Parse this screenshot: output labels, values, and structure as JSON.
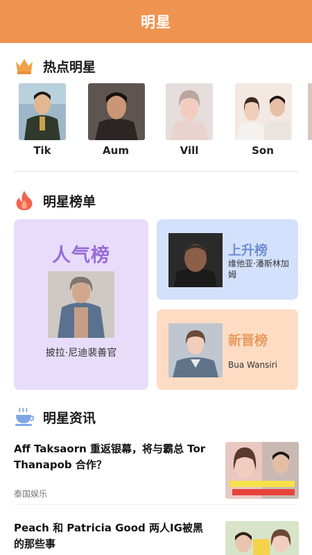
{
  "header": {
    "title": "明星"
  },
  "hot_stars": {
    "title": "热点明星",
    "icon": "crown-icon",
    "items": [
      {
        "name": "Tik"
      },
      {
        "name": "Aum"
      },
      {
        "name": "Vill"
      },
      {
        "name": "Son"
      }
    ]
  },
  "ranking": {
    "title": "明星榜单",
    "icon": "flame-icon",
    "popular": {
      "title": "人气榜",
      "star": "披拉·尼迪裴善官"
    },
    "rising": {
      "title": "上升榜",
      "star": "维他亚·潘斯林加姆"
    },
    "new": {
      "title": "新晋榜",
      "star": "Bua Wansiri"
    }
  },
  "news": {
    "title": "明星资讯",
    "icon": "coffee-cup-icon",
    "items": [
      {
        "title": "Aff Taksaorn 重返银幕，将与霸总 Tor Thanapob 合作？",
        "tag": "泰国娱乐"
      },
      {
        "title": "Peach 和 Patricia Good 两人IG被黑的那些事",
        "tag": ""
      }
    ]
  },
  "colors": {
    "header": "#EE9450",
    "popular_card": "#E7DDFB",
    "rising_card": "#D4E1FC",
    "new_card": "#FEDCC4"
  }
}
